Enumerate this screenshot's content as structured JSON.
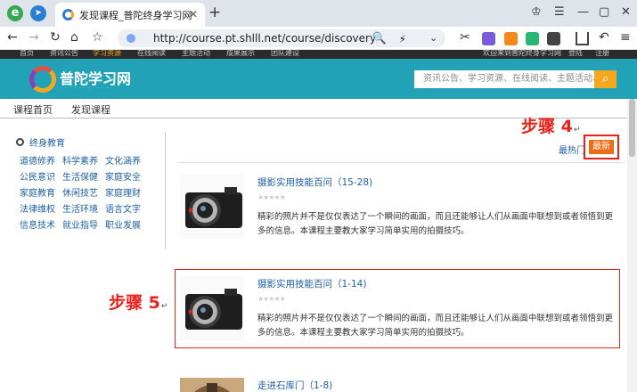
{
  "browser": {
    "tab_title": "发现课程_普陀终身学习网",
    "tab_close": "✕",
    "new_tab": "+",
    "url": "http://course.pt.shlll.net/course/discovery"
  },
  "site": {
    "top_links": [
      "首页",
      "资讯公告",
      "学习资源",
      "在线阅读",
      "主题活动",
      "成果展示",
      "团队建设"
    ],
    "top_active_index": 2,
    "top_right": [
      "欢迎来到普陀终身学习网",
      "登陆",
      "注册"
    ],
    "logo_text": "普陀学习网",
    "search_placeholder": "资讯公告、学习资源、在线阅读、主题活动、成果展示",
    "subnav": [
      "课程首页",
      "发现课程"
    ]
  },
  "sidebar": {
    "heading": "终身教育",
    "categories": [
      "道德修养",
      "科学素养",
      "文化涵养",
      "公民意识",
      "生活保健",
      "家庭安全",
      "家庭教育",
      "休闲技艺",
      "家庭理财",
      "法律维权",
      "生活环境",
      "语言文字",
      "信息技术",
      "就业指导",
      "职业发展"
    ]
  },
  "sort": {
    "hot": "最热门",
    "new": "最新"
  },
  "annotations": {
    "step4": "步骤 4",
    "step5": "步骤 5"
  },
  "courses": [
    {
      "title": "摄影实用技能百问（15-28)",
      "stars": "★★★★★",
      "description": "精彩的照片并不是仅仅表达了一个瞬间的画面，而且还能够让人们从画面中联想到或者领悟到更多的信息。本课程主要教大家学习简单实用的拍摄技巧。"
    },
    {
      "title": "摄影实用技能百问（1-14)",
      "stars": "★★★★★",
      "description": "精彩的照片并不是仅仅表达了一个瞬间的画面，而且还能够让人们从画面中联想到或者领悟到更多的信息。本课程主要教大家学习简单实用的拍摄技巧。"
    },
    {
      "title": "走进石库门（1-8)"
    }
  ],
  "colors": {
    "teal_header": "#21a2b6",
    "accent_orange": "#ee6d19",
    "annotation_red": "#e8221b",
    "link_blue": "#1d5fa6"
  }
}
